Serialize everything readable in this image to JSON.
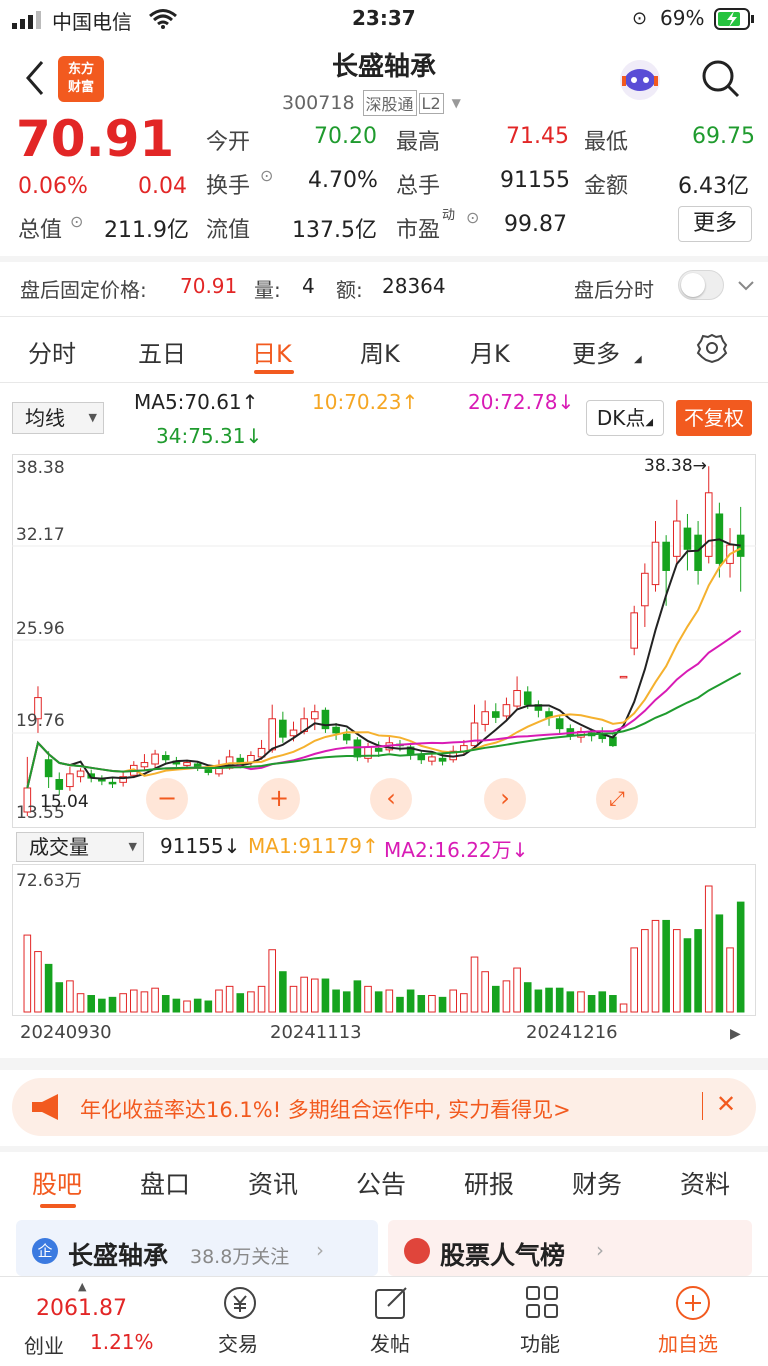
{
  "status": {
    "carrier": "中国电信",
    "time": "23:37",
    "battery": "69%"
  },
  "header": {
    "title": "长盛轴承",
    "code": "300718",
    "badge1": "深股通",
    "badge2": "L2",
    "logo_line1": "东方",
    "logo_line2": "财富"
  },
  "quote": {
    "price": "70.91",
    "pct": "0.06%",
    "chg": "0.04",
    "total_value_label": "总值",
    "total_value": "211.9亿",
    "open_label": "今开",
    "open": "70.20",
    "high_label": "最高",
    "high": "71.45",
    "low_label": "最低",
    "low": "69.75",
    "turnover_label": "换手",
    "turnover": "4.70%",
    "volume_label": "总手",
    "volume": "91155",
    "amount_label": "金额",
    "amount": "6.43亿",
    "float_label": "流值",
    "float": "137.5亿",
    "pe_label": "市盈",
    "pe_sup": "动",
    "pe": "99.87",
    "more": "更多"
  },
  "afterhours": {
    "label": "盘后固定价格:",
    "price": "70.91",
    "qty_label": "量:",
    "qty": "4",
    "amt_label": "额:",
    "amt": "28364",
    "toggle_label": "盘后分时"
  },
  "tabs": [
    "分时",
    "五日",
    "日K",
    "周K",
    "月K",
    "更多"
  ],
  "ma": {
    "select": "均线",
    "ma5": "MA5:70.61↑",
    "ma10": "10:70.23↑",
    "ma20": "20:72.78↓",
    "ma34": "34:75.31↓",
    "dk": "DK点",
    "fq": "不复权"
  },
  "chart_labels": {
    "y1": "38.38",
    "y2": "32.17",
    "y3": "25.96",
    "y4": "19.76",
    "y5": "13.55",
    "hi_mark": "38.38→",
    "lo_mark": "15.04"
  },
  "vol": {
    "select": "成交量",
    "value": "91155↓",
    "ma1": "MA1:91179↑",
    "ma2": "MA2:16.22万↓",
    "ymax": "72.63万"
  },
  "dates": [
    "20240930",
    "20241113",
    "20241216"
  ],
  "banner": {
    "text": "年化收益率达16.1%! 多期组合运作中, 实力看得见>"
  },
  "bottom_tabs": [
    "股吧",
    "盘口",
    "资讯",
    "公告",
    "研报",
    "财务",
    "资料"
  ],
  "cards": {
    "left_title": "长盛轴承",
    "left_sub": "38.8万关注",
    "right_title": "股票人气榜"
  },
  "nav": {
    "index_val": "2061.87",
    "index_name": "创业",
    "index_pct": "1.21%",
    "trade": "交易",
    "post": "发帖",
    "func": "功能",
    "add": "加自选"
  },
  "chart_data": {
    "type": "candlestick",
    "ylim": [
      13.55,
      38.38
    ],
    "yticks": [
      38.38,
      32.17,
      25.96,
      19.76,
      13.55
    ],
    "candles": [
      [
        13.9,
        15.6,
        17.8,
        13.6
      ],
      [
        20.5,
        22.0,
        22.8,
        19.5
      ],
      [
        17.6,
        16.4,
        18.2,
        15.6
      ],
      [
        16.2,
        15.5,
        16.7,
        15.1
      ],
      [
        15.7,
        16.6,
        17.1,
        15.4
      ],
      [
        16.4,
        16.8,
        17.0,
        16.0
      ],
      [
        16.6,
        16.3,
        16.9,
        16.0
      ],
      [
        16.2,
        16.1,
        16.5,
        15.8
      ],
      [
        16.0,
        15.9,
        16.4,
        15.6
      ],
      [
        16.0,
        16.4,
        16.7,
        15.7
      ],
      [
        16.5,
        17.2,
        17.5,
        16.3
      ],
      [
        17.1,
        17.4,
        18.0,
        16.9
      ],
      [
        17.3,
        18.0,
        18.3,
        17.0
      ],
      [
        17.9,
        17.6,
        18.2,
        17.3
      ],
      [
        17.5,
        17.3,
        17.8,
        17.1
      ],
      [
        17.2,
        17.4,
        17.6,
        17.0
      ],
      [
        17.3,
        17.0,
        17.5,
        16.8
      ],
      [
        16.9,
        16.7,
        17.1,
        16.5
      ],
      [
        16.6,
        17.1,
        17.6,
        16.4
      ],
      [
        17.0,
        17.8,
        18.3,
        16.9
      ],
      [
        17.7,
        17.3,
        18.0,
        17.0
      ],
      [
        17.4,
        17.9,
        18.2,
        17.1
      ],
      [
        17.8,
        18.4,
        19.0,
        17.6
      ],
      [
        18.3,
        20.5,
        21.5,
        18.1
      ],
      [
        20.4,
        19.2,
        21.0,
        18.8
      ],
      [
        19.3,
        19.7,
        20.3,
        18.9
      ],
      [
        19.6,
        20.5,
        21.3,
        19.4
      ],
      [
        20.5,
        21.0,
        21.5,
        19.7
      ],
      [
        21.1,
        19.8,
        21.3,
        19.5
      ],
      [
        19.9,
        19.5,
        20.2,
        19.0
      ],
      [
        19.4,
        19.0,
        19.8,
        18.7
      ],
      [
        19.0,
        17.8,
        19.2,
        17.5
      ],
      [
        17.7,
        18.5,
        18.8,
        17.4
      ],
      [
        18.4,
        18.2,
        18.9,
        17.8
      ],
      [
        18.3,
        18.8,
        19.3,
        18.1
      ],
      [
        18.7,
        18.6,
        19.0,
        18.2
      ],
      [
        18.5,
        18.0,
        18.8,
        17.6
      ],
      [
        17.9,
        17.6,
        18.2,
        17.3
      ],
      [
        17.5,
        17.8,
        18.1,
        17.2
      ],
      [
        17.7,
        17.5,
        18.0,
        17.2
      ],
      [
        17.6,
        18.2,
        18.6,
        17.4
      ],
      [
        18.2,
        18.6,
        19.0,
        18.0
      ],
      [
        18.6,
        20.2,
        21.5,
        18.5
      ],
      [
        20.1,
        21.0,
        21.8,
        19.6
      ],
      [
        21.0,
        20.6,
        21.6,
        20.2
      ],
      [
        20.7,
        21.5,
        22.0,
        20.3
      ],
      [
        21.4,
        22.5,
        23.5,
        21.1
      ],
      [
        22.4,
        21.5,
        22.8,
        21.2
      ],
      [
        21.5,
        21.1,
        21.8,
        20.6
      ],
      [
        21.0,
        20.6,
        21.3,
        20.0
      ],
      [
        20.5,
        19.8,
        20.7,
        19.4
      ],
      [
        19.8,
        19.3,
        20.1,
        19.0
      ],
      [
        19.2,
        19.6,
        19.9,
        18.8
      ],
      [
        19.5,
        19.3,
        19.8,
        18.9
      ],
      [
        19.4,
        19.1,
        19.9,
        18.8
      ],
      [
        19.2,
        18.6,
        19.4,
        18.5
      ],
      [
        23.5,
        23.5,
        23.5,
        23.5
      ],
      [
        25.5,
        28.0,
        28.5,
        25.0
      ],
      [
        28.5,
        30.8,
        31.5,
        27.0
      ],
      [
        30.0,
        33.0,
        34.5,
        29.5
      ],
      [
        33.0,
        31.0,
        33.5,
        28.5
      ],
      [
        32.0,
        34.5,
        36.0,
        31.5
      ],
      [
        34.0,
        32.5,
        35.0,
        31.0
      ],
      [
        33.5,
        31.0,
        34.5,
        30.0
      ],
      [
        32.0,
        36.5,
        38.38,
        31.5
      ],
      [
        35.0,
        31.5,
        35.8,
        30.5
      ],
      [
        31.5,
        32.8,
        34.0,
        30.5
      ],
      [
        33.5,
        32.0,
        35.5,
        29.5
      ]
    ],
    "ma_lines": [
      "MA5",
      "MA10",
      "MA20",
      "MA34"
    ]
  }
}
